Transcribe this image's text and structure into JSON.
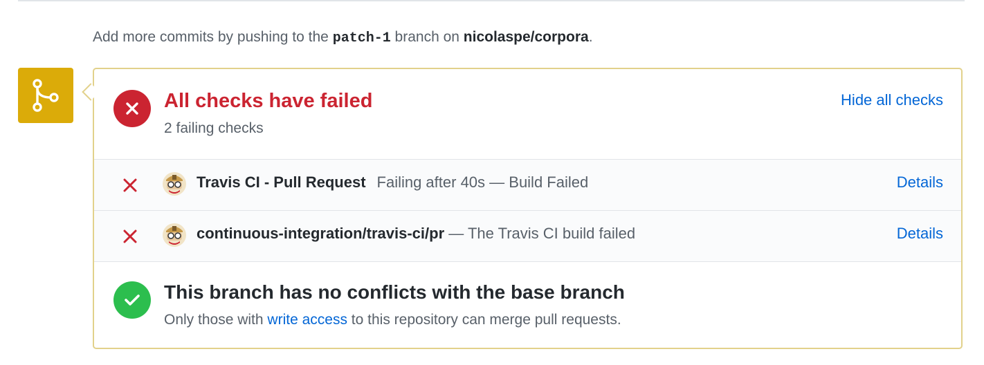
{
  "commit_note": {
    "prefix": "Add more commits by pushing to the",
    "branch": "patch-1",
    "middle": "branch on",
    "repo": "nicolaspe/corpora",
    "suffix": "."
  },
  "checks": {
    "title": "All checks have failed",
    "subtitle": "2 failing checks",
    "toggle_label": "Hide all checks",
    "rows": [
      {
        "context": "Travis CI - Pull Request",
        "description": "Failing after 40s — Build Failed",
        "details_label": "Details"
      },
      {
        "context": "continuous-integration/travis-ci/pr",
        "description": "— The Travis CI build failed",
        "details_label": "Details"
      }
    ]
  },
  "merge": {
    "title": "This branch has no conflicts with the base branch",
    "sub_prefix": "Only those with",
    "sub_link": "write access",
    "sub_suffix": "to this repository can merge pull requests."
  },
  "colors": {
    "fail": "#cb2431",
    "success": "#2cbe4e",
    "pending": "#dbab09",
    "link": "#0366d6"
  },
  "icons": {
    "merge_state": "git-merge-icon",
    "fail": "x-icon",
    "success": "check-icon",
    "avatar": "travis-ci-avatar"
  }
}
